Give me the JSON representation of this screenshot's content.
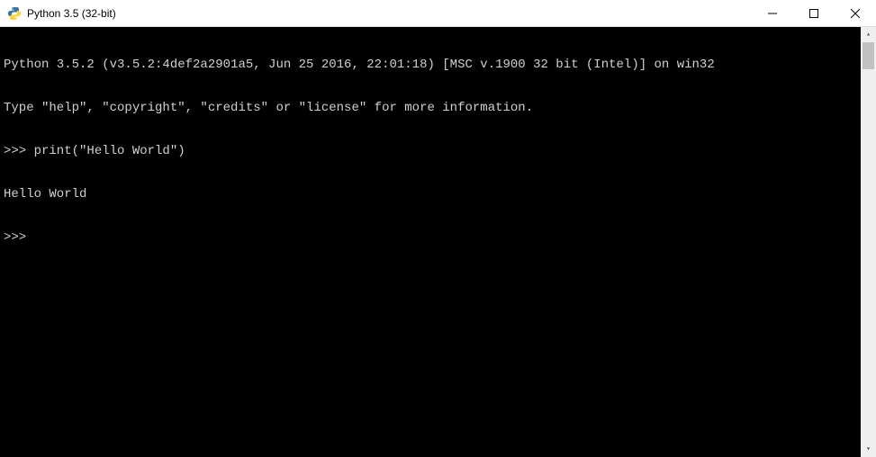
{
  "window": {
    "title": "Python 3.5 (32-bit)"
  },
  "terminal": {
    "lines": [
      "Python 3.5.2 (v3.5.2:4def2a2901a5, Jun 25 2016, 22:01:18) [MSC v.1900 32 bit (Intel)] on win32",
      "Type \"help\", \"copyright\", \"credits\" or \"license\" for more information.",
      ">>> print(\"Hello World\")",
      "Hello World",
      ">>>"
    ]
  }
}
